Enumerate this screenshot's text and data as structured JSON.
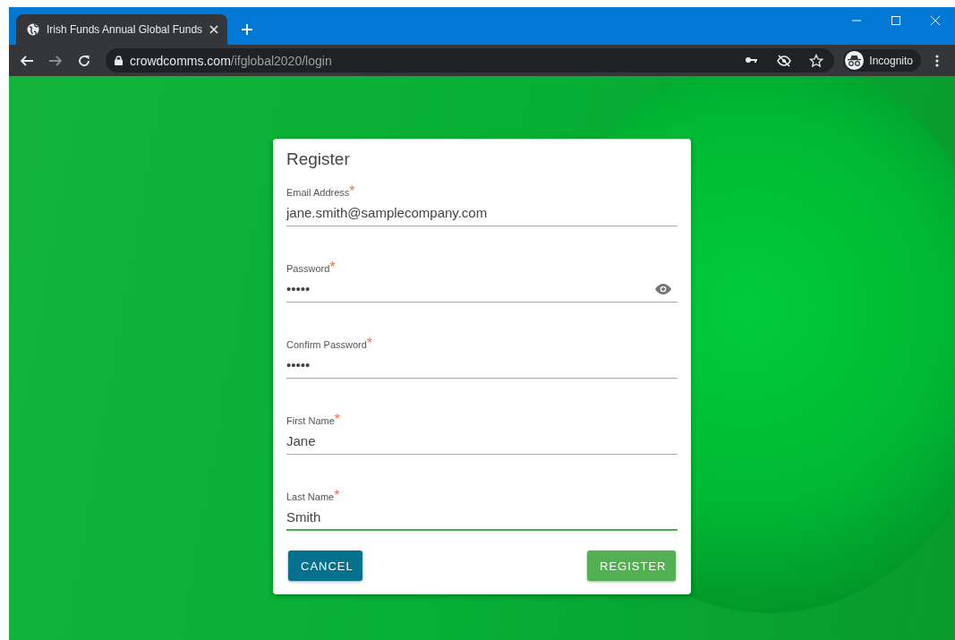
{
  "browser": {
    "tab": {
      "title": "Irish Funds Annual Global Funds",
      "selected": true
    },
    "url_host": "crowdcomms.com",
    "url_path": "/ifglobal2020/login",
    "profile": "Incognito"
  },
  "form": {
    "title": "Register",
    "fields": [
      {
        "kind": "text",
        "label": "Email Address",
        "required": true,
        "required_mark": "*",
        "value": "jane.smith@samplecompany.com",
        "focused": false
      },
      {
        "kind": "password",
        "label": "Password",
        "required": true,
        "required_mark": "*",
        "value": "•••••",
        "focused": false
      },
      {
        "kind": "text",
        "label": "Confirm Password",
        "required": true,
        "required_mark": "*",
        "value": "•••••",
        "focused": false
      },
      {
        "kind": "text",
        "label": "First Name",
        "required": true,
        "required_mark": "*",
        "value": "Jane",
        "focused": false
      },
      {
        "kind": "text",
        "label": "Last Name",
        "required": true,
        "required_mark": "*",
        "value": "Smith",
        "focused": true
      }
    ],
    "buttons": [
      {
        "kind": "secondary",
        "label": "CANCEL"
      },
      {
        "kind": "primary",
        "label": "REGISTER"
      }
    ]
  }
}
